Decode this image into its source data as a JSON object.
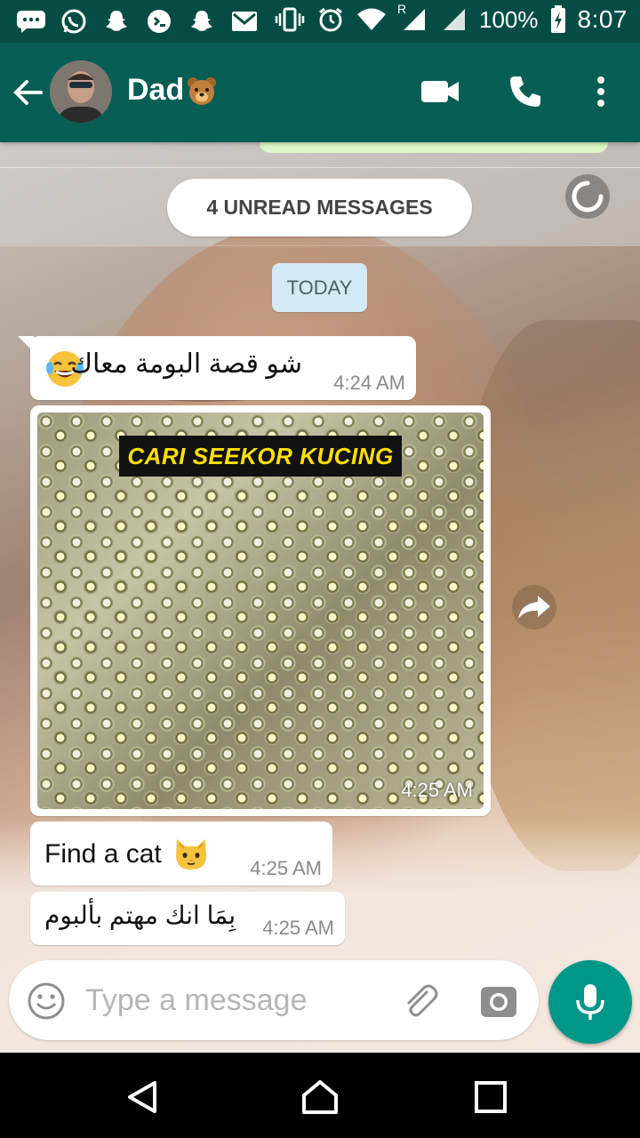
{
  "status_bar": {
    "battery": "100%",
    "time": "8:07",
    "network_label": "R"
  },
  "header": {
    "contact_name": "Dad",
    "icons": [
      "back-arrow-icon",
      "video-call-icon",
      "phone-icon",
      "more-vert-icon"
    ]
  },
  "chat": {
    "unread_banner": "4 UNREAD MESSAGES",
    "date_chip": "TODAY",
    "messages": [
      {
        "text": "شو قصة البومة معاك",
        "emoji": "face-with-tears-of-joy",
        "time": "4:24 AM"
      },
      {
        "type": "image",
        "image_caption_text": "CARI SEEKOR KUCING",
        "time": "4:25 AM"
      },
      {
        "text": "Find a cat",
        "emoji": "cat-face",
        "time": "4:25 AM"
      },
      {
        "text": "بِمَا انك مهتم بألبوم",
        "time": "4:25 AM"
      }
    ]
  },
  "composer": {
    "placeholder": "Type a message"
  },
  "colors": {
    "app_bar": "#075e54",
    "status_bar": "#054d44",
    "mic_button": "#009688",
    "date_chip": "#d4eaf4",
    "banner_text": "#ffe000"
  }
}
